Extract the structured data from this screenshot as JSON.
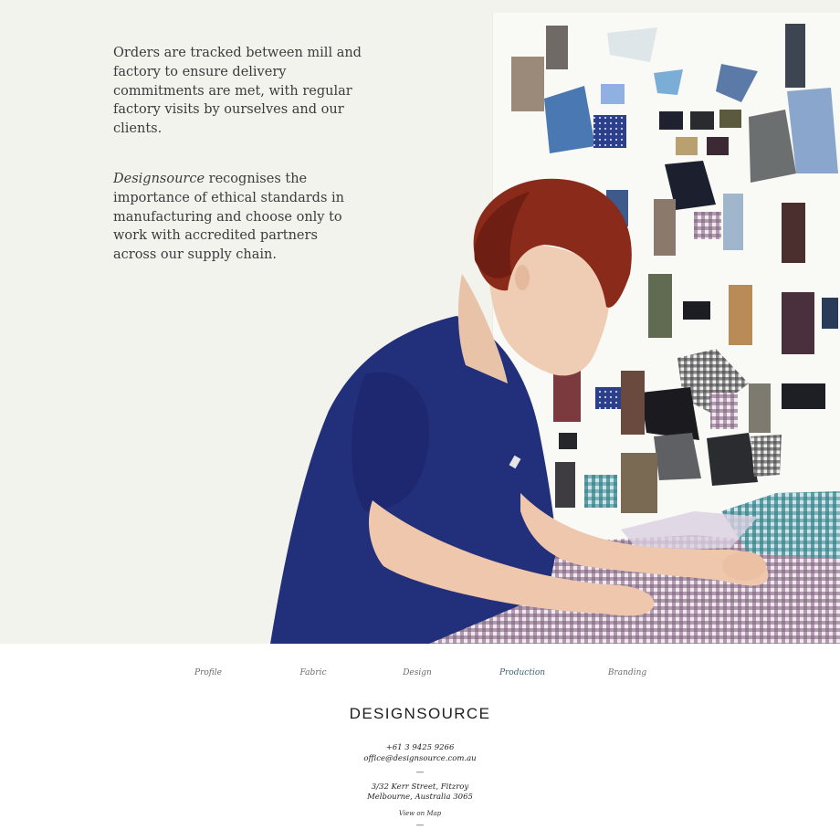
{
  "intro": {
    "paragraph1": "Orders are tracked between mill and factory to ensure delivery commitments are met, with regular factory visits by ourselves and our clients.",
    "paragraph2_brand": "Designsource",
    "paragraph2_rest": " recognises the importance of ethical standards in manufacturing and choose only to work with accredited partners across our supply chain."
  },
  "nav": {
    "items": [
      {
        "label": "Profile"
      },
      {
        "label": "Fabric"
      },
      {
        "label": "Design"
      },
      {
        "label": "Production"
      },
      {
        "label": "Branding"
      }
    ],
    "active": "Production"
  },
  "footer": {
    "brand": "DESIGNSOURCE",
    "phone": "+61 3 9425 9266",
    "email": "office@designsource.com.au",
    "separator": "—",
    "address_line1": "3/32 Kerr Street, Fitzroy",
    "address_line2": "Melbourne, Australia 3065",
    "map_link": "View on Map",
    "separator2": "—"
  },
  "colors": {
    "page_bg": "#f3f3ee",
    "accent_active": "#3f6272",
    "shirt": "#222f7a",
    "hair": "#8a2a1a"
  },
  "hero_image": "woman-inspecting-checked-fabric-in-front-of-moodboard"
}
